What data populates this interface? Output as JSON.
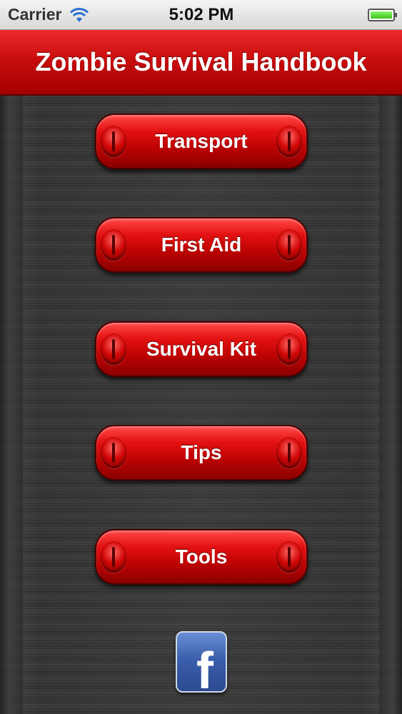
{
  "status_bar": {
    "carrier": "Carrier",
    "time": "5:02 PM",
    "battery_level": 1.0
  },
  "header": {
    "title": "Zombie Survival Handbook"
  },
  "menu": {
    "items": [
      {
        "label": "Transport"
      },
      {
        "label": "First Aid"
      },
      {
        "label": "Survival Kit"
      },
      {
        "label": "Tips"
      },
      {
        "label": "Tools"
      }
    ]
  },
  "social": {
    "facebook_glyph": "f",
    "icon": "facebook-icon"
  },
  "colors": {
    "header_red": "#c90d0d",
    "button_red": "#e31212",
    "background": "#3b3b3b",
    "facebook_blue": "#3b5fab"
  }
}
